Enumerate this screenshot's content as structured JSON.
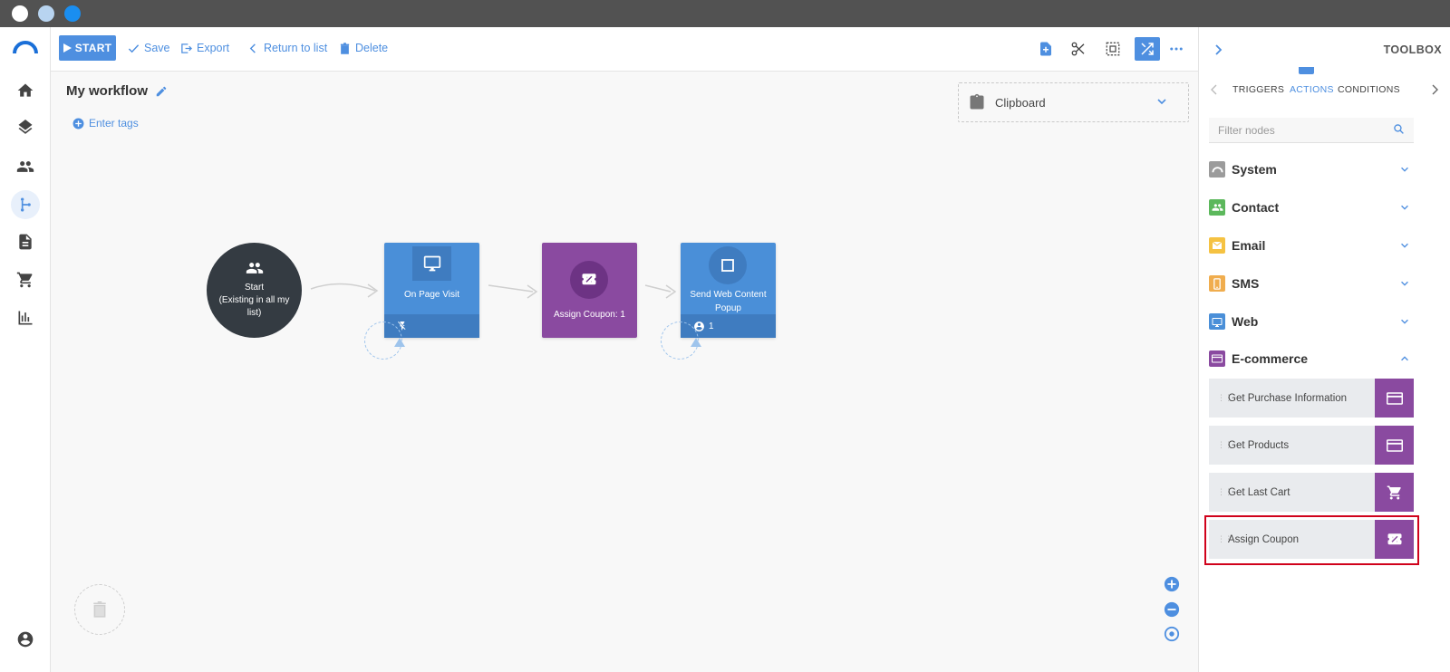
{
  "window": {
    "controls": [
      "close",
      "minimize",
      "maximize"
    ]
  },
  "sidebar": {
    "icons": [
      "home-icon",
      "layers-icon",
      "contacts-icon",
      "workflow-icon",
      "document-icon",
      "cart-icon",
      "chart-icon",
      "account-icon"
    ],
    "active": "workflow-icon"
  },
  "toolbar": {
    "start_label": "START",
    "save_label": "Save",
    "export_label": "Export",
    "return_label": "Return to list",
    "delete_label": "Delete"
  },
  "canvas": {
    "workflow_title": "My workflow",
    "enter_tags_label": "Enter tags",
    "clipboard_label": "Clipboard",
    "nodes": {
      "start": {
        "title": "Start",
        "subtitle": "(Existing in all my list)"
      },
      "on_page_visit": {
        "label": "On Page Visit"
      },
      "assign_coupon": {
        "label": "Assign Coupon: 1"
      },
      "send_web_content": {
        "label": "Send Web Content Popup",
        "count": "1"
      }
    }
  },
  "toolbox": {
    "title": "TOOLBOX",
    "tabs": [
      "TRIGGERS",
      "ACTIONS",
      "CONDITIONS"
    ],
    "active_tab": "ACTIONS",
    "filter_placeholder": "Filter nodes",
    "categories": [
      {
        "label": "System",
        "color": "#9b9b9b",
        "expanded": false
      },
      {
        "label": "Contact",
        "color": "#5cb85c",
        "expanded": false
      },
      {
        "label": "Email",
        "color": "#f5c242",
        "expanded": false
      },
      {
        "label": "SMS",
        "color": "#f0ad4e",
        "expanded": false
      },
      {
        "label": "Web",
        "color": "#4a8fd8",
        "expanded": false
      },
      {
        "label": "E-commerce",
        "color": "#8a4aa0",
        "expanded": true
      }
    ],
    "ecommerce_items": [
      {
        "label": "Get Purchase Information",
        "icon": "credit-card-icon"
      },
      {
        "label": "Get Products",
        "icon": "credit-card-icon"
      },
      {
        "label": "Get Last Cart",
        "icon": "cart-icon"
      },
      {
        "label": "Assign Coupon",
        "icon": "coupon-icon"
      }
    ],
    "highlighted_item": "Assign Coupon"
  }
}
